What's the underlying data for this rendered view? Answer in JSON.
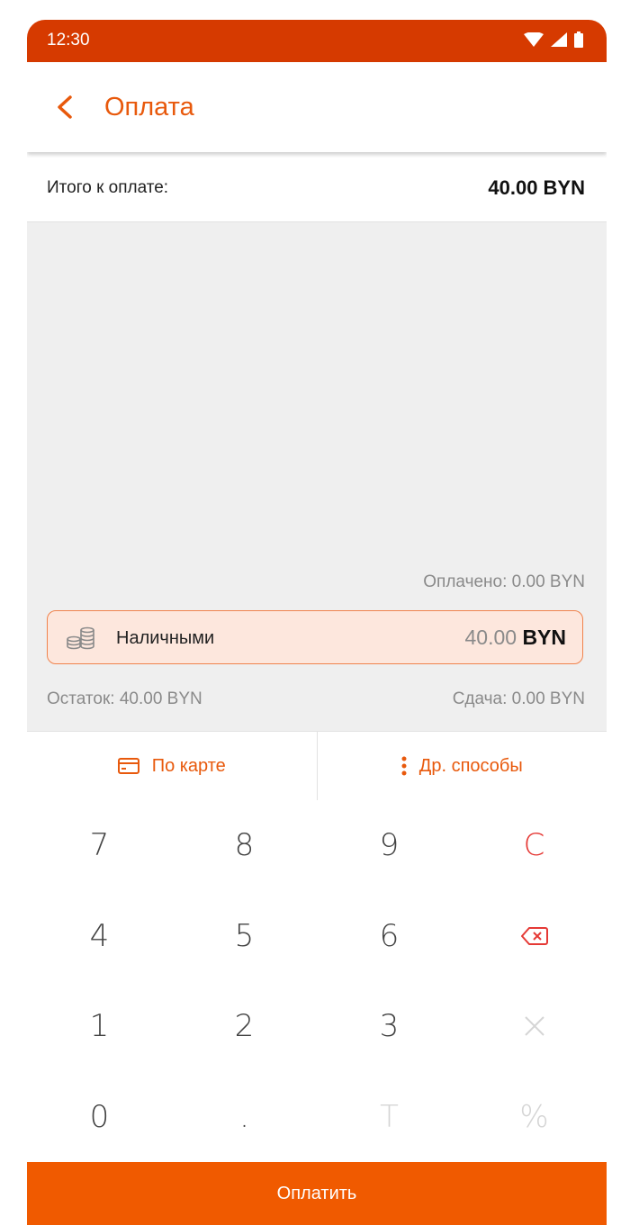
{
  "status_bar": {
    "time": "12:30"
  },
  "app_bar": {
    "title": "Оплата"
  },
  "total": {
    "label": "Итого к оплате:",
    "value": "40.00 BYN"
  },
  "payment": {
    "paid": "Оплачено: 0.00 BYN",
    "cash": {
      "label": "Наличными",
      "amount": "40.00",
      "currency": "BYN"
    },
    "rest": "Остаток: 40.00 BYN",
    "change": "Сдача: 0.00 BYN"
  },
  "methods": {
    "card": "По карте",
    "other": "Др. способы"
  },
  "keypad": {
    "k7": "7",
    "k8": "8",
    "k9": "9",
    "clear": "C",
    "k4": "4",
    "k5": "5",
    "k6": "6",
    "k1": "1",
    "k2": "2",
    "k3": "3",
    "k0": "0",
    "dot": ".",
    "t": "T",
    "percent": "%"
  },
  "pay_button": "Оплатить",
  "colors": {
    "accent": "#e8590c",
    "status_bar": "#d63a00",
    "pay_button": "#f05a00",
    "clear": "#e53935"
  }
}
